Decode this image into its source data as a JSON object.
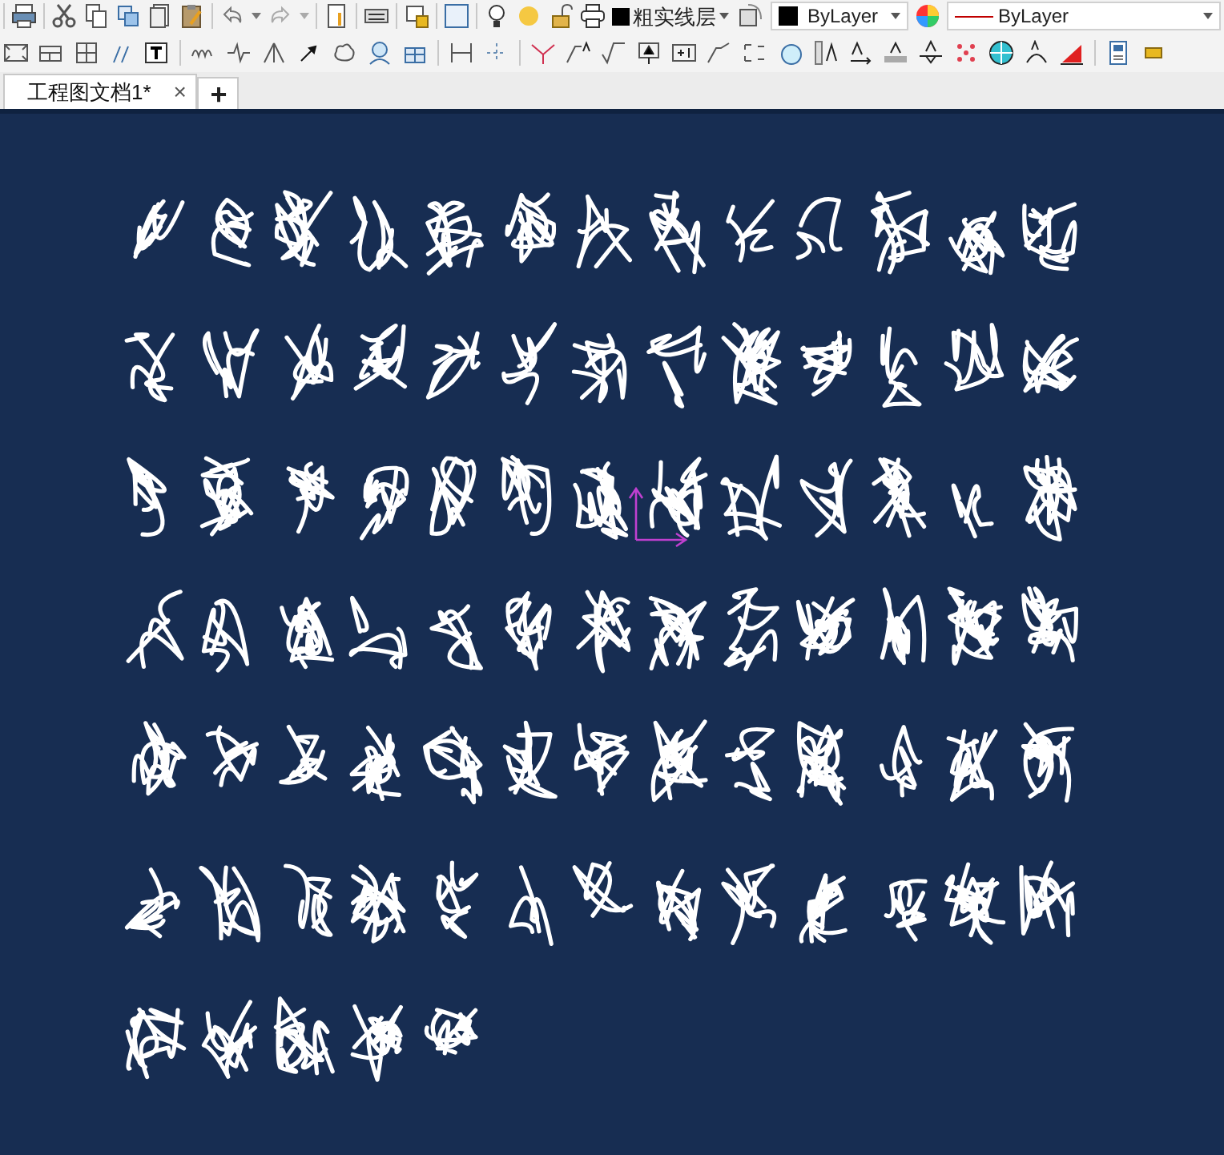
{
  "toolbar": {
    "layer_dropdown": {
      "value": "粗实线层"
    },
    "color_dropdown": {
      "value": "ByLayer"
    },
    "linetype_dropdown": {
      "value": "ByLayer"
    }
  },
  "tabs": [
    {
      "label": "工程图文档1*",
      "selected": true,
      "close": "×"
    }
  ],
  "new_tab": {
    "label": "+"
  }
}
